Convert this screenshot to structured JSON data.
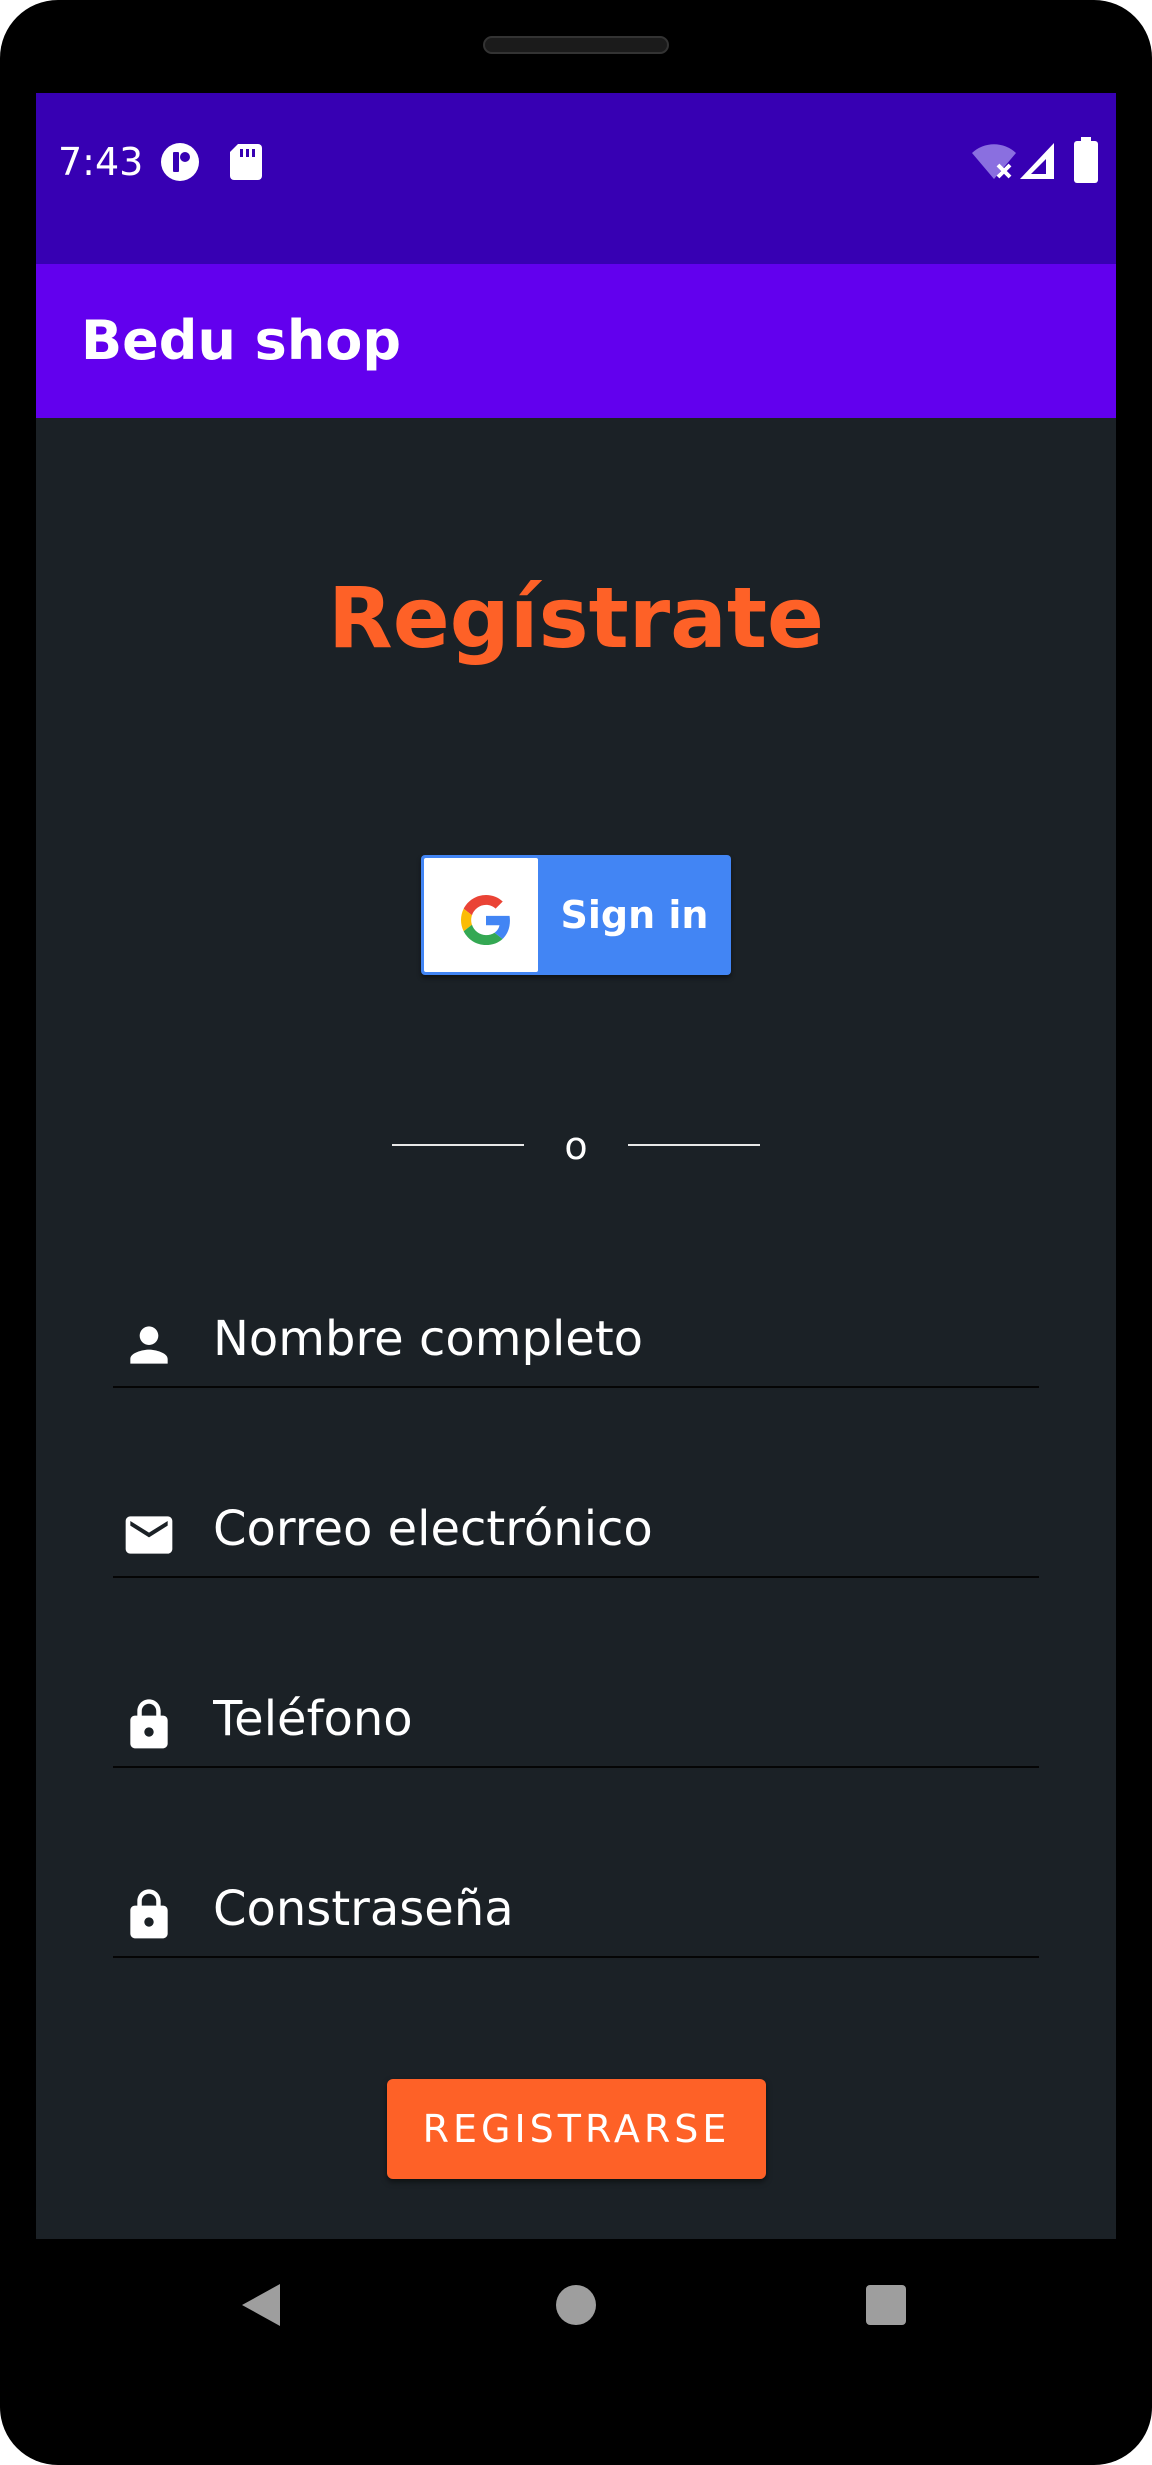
{
  "status_bar": {
    "time": "7:43",
    "left_icons": [
      "app-notification-icon",
      "sd-card-icon"
    ],
    "right_icons": [
      "wifi-off-icon",
      "cell-signal-icon",
      "battery-icon"
    ]
  },
  "app_bar": {
    "title": "Bedu shop"
  },
  "main": {
    "heading": "Regístrate",
    "google_button": {
      "label": "Sign in",
      "icon": "google-g-icon"
    },
    "divider_text": "o",
    "fields": [
      {
        "placeholder": "Nombre completo",
        "icon": "person-icon"
      },
      {
        "placeholder": "Correo electrónico",
        "icon": "email-icon"
      },
      {
        "placeholder": "Teléfono",
        "icon": "lock-icon"
      },
      {
        "placeholder": "Constraseña",
        "icon": "lock-icon"
      }
    ],
    "register_button": "REGISTRARSE"
  },
  "nav_bar": {
    "buttons": [
      "back-icon",
      "home-icon",
      "recents-icon"
    ]
  },
  "colors": {
    "status_bar": "#3700b3",
    "app_bar": "#6200ee",
    "background": "#1b2126",
    "accent": "#fe6127",
    "google_blue": "#4285f4"
  }
}
